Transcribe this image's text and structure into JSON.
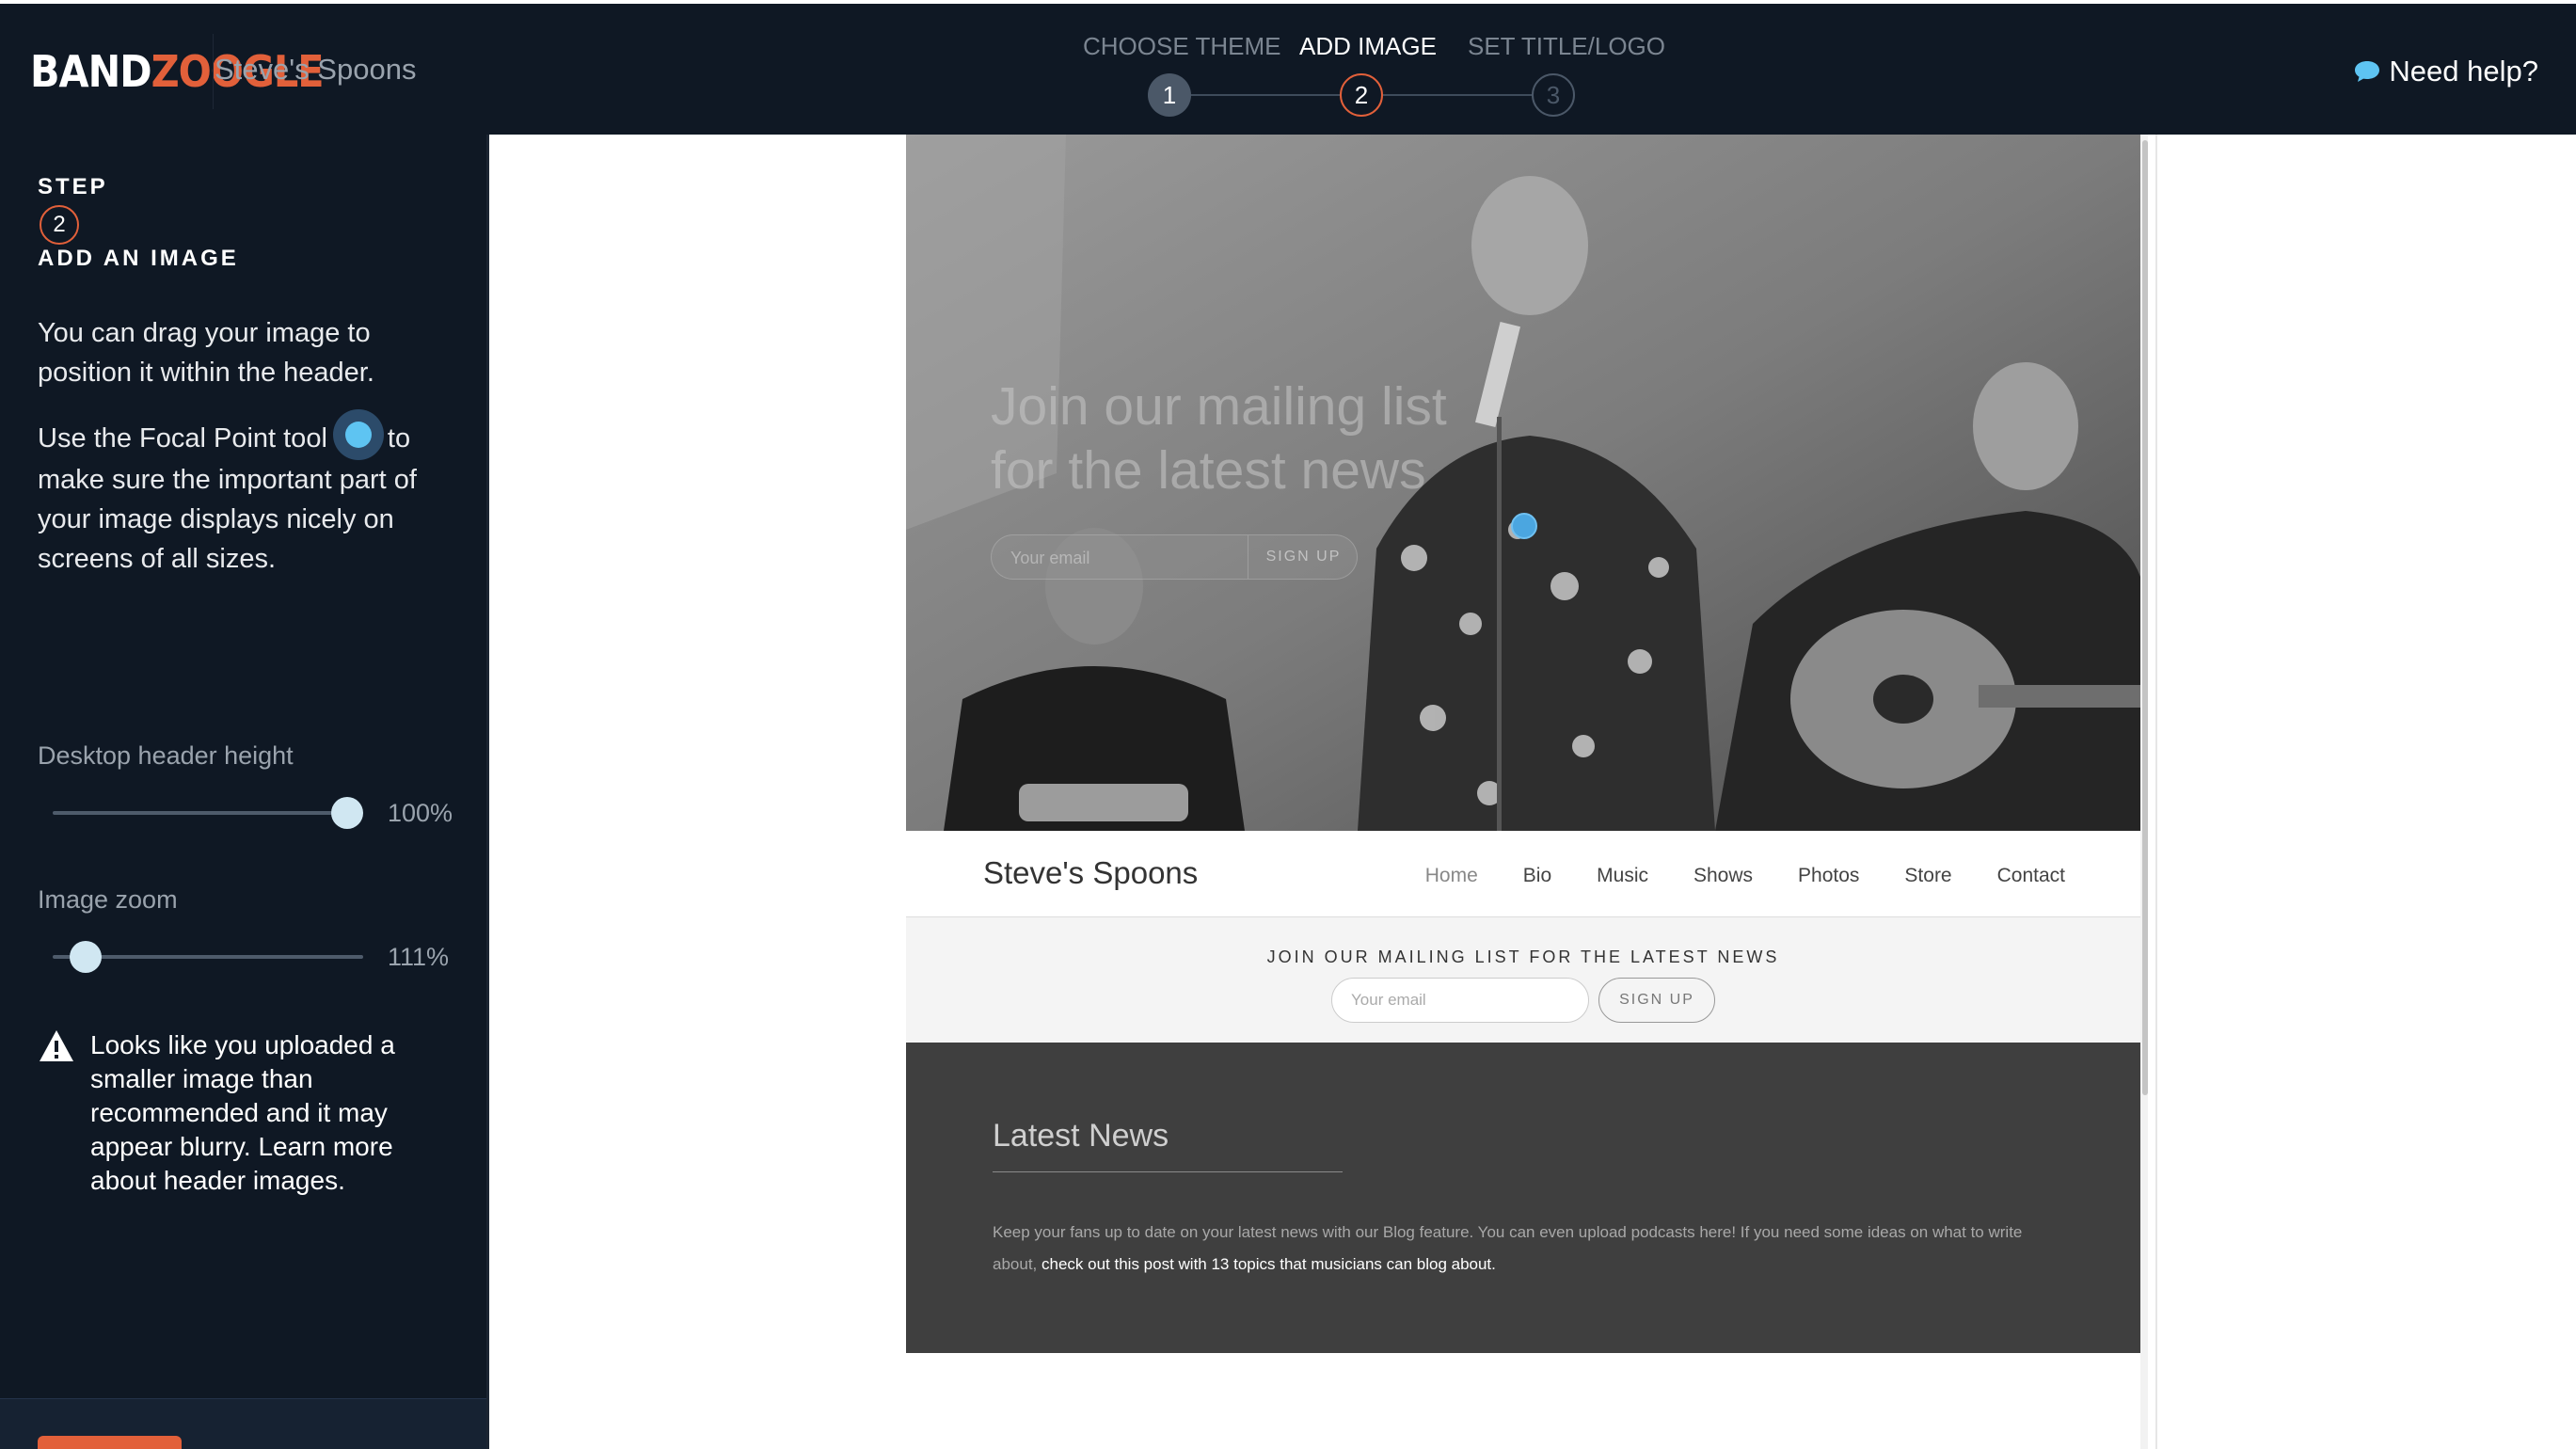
{
  "app": {
    "logo_part1": "BAND",
    "logo_part2": "ZOOGLE",
    "site_name": "Steve's Spoons",
    "help_label": "Need help?",
    "brand_color": "#e2603a",
    "dark_bg": "#0f1824"
  },
  "wizard": {
    "steps": [
      {
        "label": "CHOOSE THEME",
        "number": "1",
        "state": "done"
      },
      {
        "label": "ADD IMAGE",
        "number": "2",
        "state": "current"
      },
      {
        "label": "SET TITLE/LOGO",
        "number": "3",
        "state": "todo"
      }
    ]
  },
  "sidebar": {
    "step_heading": "STEP",
    "step_number": "2",
    "step_title": "ADD AN IMAGE",
    "para1": "You can drag your image to position it within the header.",
    "para2_before": "Use the Focal Point tool",
    "para2_after": "to make sure the important part of your image displays nicely on screens of all sizes.",
    "sliders": [
      {
        "label": "Desktop header height",
        "value_label": "100%",
        "value": 1.0
      },
      {
        "label": "Image zoom",
        "value_label": "111%",
        "value": 0.06
      }
    ],
    "warning": "Looks like you uploaded a smaller image than recommended and it may appear blurry. Learn more about header images."
  },
  "preview": {
    "hero": {
      "title_line1": "Join our mailing list",
      "title_line2": "for the latest news",
      "email_placeholder": "Your email",
      "button": "SIGN UP"
    },
    "nav": {
      "brand": "Steve's Spoons",
      "links": [
        "Home",
        "Bio",
        "Music",
        "Shows",
        "Photos",
        "Store",
        "Contact"
      ]
    },
    "mailing": {
      "title": "JOIN OUR MAILING LIST FOR THE LATEST NEWS",
      "email_placeholder": "Your email",
      "button": "SIGN UP"
    },
    "news": {
      "title": "Latest News",
      "body": "Keep your fans up to date on your latest news with our Blog feature. You can even upload podcasts here! If you need some ideas on what to write about,",
      "link": "check out this post with 13 topics that musicians can blog about."
    }
  }
}
